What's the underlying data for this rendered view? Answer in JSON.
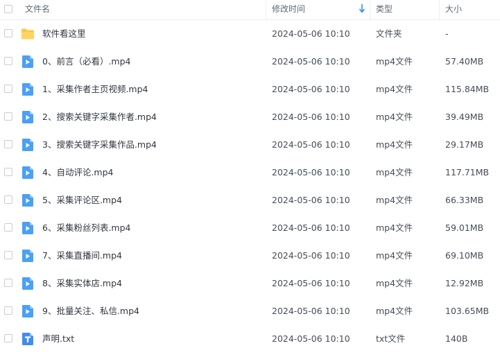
{
  "header": {
    "name": "文件名",
    "modified": "修改时间",
    "type": "类型",
    "size": "大小"
  },
  "files": [
    {
      "name": "软件看这里",
      "modified": "2024-05-06 10:10",
      "type": "文件夹",
      "size": "-",
      "icon": "folder-icon"
    },
    {
      "name": "0、前言（必看）.mp4",
      "modified": "2024-05-06 10:10",
      "type": "mp4文件",
      "size": "57.40MB",
      "icon": "video-file-icon"
    },
    {
      "name": "1、采集作者主页视频.mp4",
      "modified": "2024-05-06 10:10",
      "type": "mp4文件",
      "size": "115.84MB",
      "icon": "video-file-icon"
    },
    {
      "name": "2、搜索关键字采集作者.mp4",
      "modified": "2024-05-06 10:10",
      "type": "mp4文件",
      "size": "39.49MB",
      "icon": "video-file-icon"
    },
    {
      "name": "3、搜索关键字采集作品.mp4",
      "modified": "2024-05-06 10:10",
      "type": "mp4文件",
      "size": "29.17MB",
      "icon": "video-file-icon"
    },
    {
      "name": "4、自动评论.mp4",
      "modified": "2024-05-06 10:10",
      "type": "mp4文件",
      "size": "117.71MB",
      "icon": "video-file-icon"
    },
    {
      "name": "5、采集评论区.mp4",
      "modified": "2024-05-06 10:10",
      "type": "mp4文件",
      "size": "66.33MB",
      "icon": "video-file-icon"
    },
    {
      "name": "6、采集粉丝列表.mp4",
      "modified": "2024-05-06 10:10",
      "type": "mp4文件",
      "size": "59.01MB",
      "icon": "video-file-icon"
    },
    {
      "name": "7、采集直播间.mp4",
      "modified": "2024-05-06 10:10",
      "type": "mp4文件",
      "size": "69.10MB",
      "icon": "video-file-icon"
    },
    {
      "name": "8、采集实体店.mp4",
      "modified": "2024-05-06 10:10",
      "type": "mp4文件",
      "size": "12.92MB",
      "icon": "video-file-icon"
    },
    {
      "name": "9、批量关注、私信.mp4",
      "modified": "2024-05-06 10:10",
      "type": "mp4文件",
      "size": "103.65MB",
      "icon": "video-file-icon"
    },
    {
      "name": "声明.txt",
      "modified": "2024-05-06 10:10",
      "type": "txt文件",
      "size": "140B",
      "icon": "text-file-icon"
    }
  ],
  "colors": {
    "accent": "#2f8cf5",
    "folder": "#ffc63f",
    "video": "#4aa0f5",
    "text_file": "#3f8df0"
  }
}
